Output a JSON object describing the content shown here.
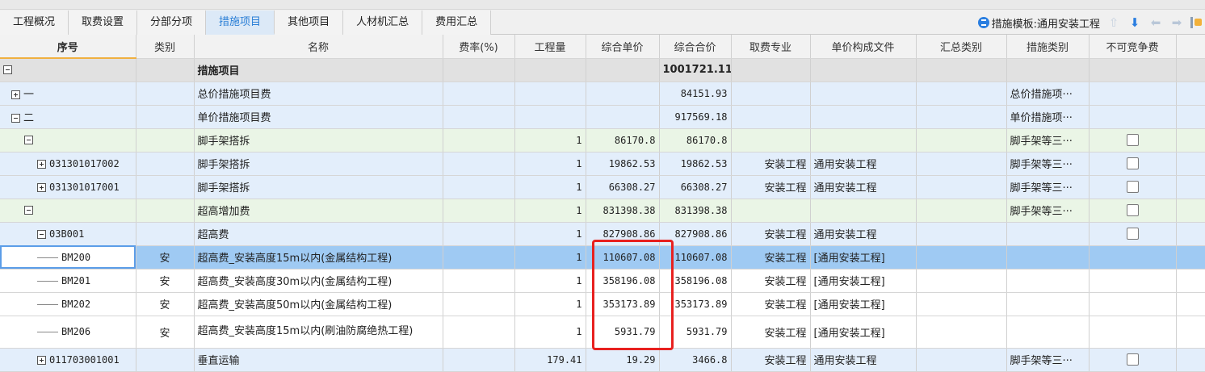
{
  "tabs": [
    "工程概况",
    "取费设置",
    "分部分项",
    "措施项目",
    "其他项目",
    "人材机汇总",
    "费用汇总"
  ],
  "active_tab": 3,
  "template_label": "措施模板:通用安装工程",
  "columns": [
    "序号",
    "类别",
    "名称",
    "费率(%)",
    "工程量",
    "综合单价",
    "综合合价",
    "取费专业",
    "单价构成文件",
    "汇总类别",
    "措施类别",
    "不可竞争费"
  ],
  "rows": [
    {
      "seq": "",
      "cat": "",
      "name": "措施项目",
      "rate": "",
      "qty": "",
      "unit_price": "",
      "total": "1001721.11",
      "major": "",
      "file": "",
      "sum_cat": "",
      "measure_cat": ""
    },
    {
      "seq": "一",
      "cat": "",
      "name": "总价措施项目费",
      "rate": "",
      "qty": "",
      "unit_price": "",
      "total": "84151.93",
      "major": "",
      "file": "",
      "sum_cat": "",
      "measure_cat": "总价措施项···"
    },
    {
      "seq": "二",
      "cat": "",
      "name": "单价措施项目费",
      "rate": "",
      "qty": "",
      "unit_price": "",
      "total": "917569.18",
      "major": "",
      "file": "",
      "sum_cat": "",
      "measure_cat": "单价措施项···"
    },
    {
      "seq": "",
      "cat": "",
      "name": "脚手架搭拆",
      "rate": "",
      "qty": "1",
      "unit_price": "86170.8",
      "total": "86170.8",
      "major": "",
      "file": "",
      "sum_cat": "",
      "measure_cat": "脚手架等三···"
    },
    {
      "seq": "031301017002",
      "cat": "",
      "name": "脚手架搭拆",
      "rate": "",
      "qty": "1",
      "unit_price": "19862.53",
      "total": "19862.53",
      "major": "安装工程",
      "file": "通用安装工程",
      "sum_cat": "",
      "measure_cat": "脚手架等三···"
    },
    {
      "seq": "031301017001",
      "cat": "",
      "name": "脚手架搭拆",
      "rate": "",
      "qty": "1",
      "unit_price": "66308.27",
      "total": "66308.27",
      "major": "安装工程",
      "file": "通用安装工程",
      "sum_cat": "",
      "measure_cat": "脚手架等三···"
    },
    {
      "seq": "",
      "cat": "",
      "name": "超高增加费",
      "rate": "",
      "qty": "1",
      "unit_price": "831398.38",
      "total": "831398.38",
      "major": "",
      "file": "",
      "sum_cat": "",
      "measure_cat": "脚手架等三···"
    },
    {
      "seq": "03B001",
      "cat": "",
      "name": "超高费",
      "rate": "",
      "qty": "1",
      "unit_price": "827908.86",
      "total": "827908.86",
      "major": "安装工程",
      "file": "通用安装工程",
      "sum_cat": "",
      "measure_cat": ""
    },
    {
      "seq": "BM200",
      "cat": "安",
      "name": "超高费_安装高度15m以内(金属结构工程)",
      "rate": "",
      "qty": "1",
      "unit_price": "110607.08",
      "total": "110607.08",
      "major": "安装工程",
      "file": "[通用安装工程]",
      "sum_cat": "",
      "measure_cat": ""
    },
    {
      "seq": "BM201",
      "cat": "安",
      "name": "超高费_安装高度30m以内(金属结构工程)",
      "rate": "",
      "qty": "1",
      "unit_price": "358196.08",
      "total": "358196.08",
      "major": "安装工程",
      "file": "[通用安装工程]",
      "sum_cat": "",
      "measure_cat": ""
    },
    {
      "seq": "BM202",
      "cat": "安",
      "name": "超高费_安装高度50m以内(金属结构工程)",
      "rate": "",
      "qty": "1",
      "unit_price": "353173.89",
      "total": "353173.89",
      "major": "安装工程",
      "file": "[通用安装工程]",
      "sum_cat": "",
      "measure_cat": ""
    },
    {
      "seq": "BM206",
      "cat": "安",
      "name": "超高费_安装高度15m以内(刷油防腐绝热工程)",
      "rate": "",
      "qty": "1",
      "unit_price": "5931.79",
      "total": "5931.79",
      "major": "安装工程",
      "file": "[通用安装工程]",
      "sum_cat": "",
      "measure_cat": ""
    },
    {
      "seq": "011703001001",
      "cat": "",
      "name": "垂直运输",
      "rate": "",
      "qty": "179.41",
      "unit_price": "19.29",
      "total": "3466.8",
      "major": "安装工程",
      "file": "通用安装工程",
      "sum_cat": "",
      "measure_cat": "脚手架等三···"
    }
  ]
}
